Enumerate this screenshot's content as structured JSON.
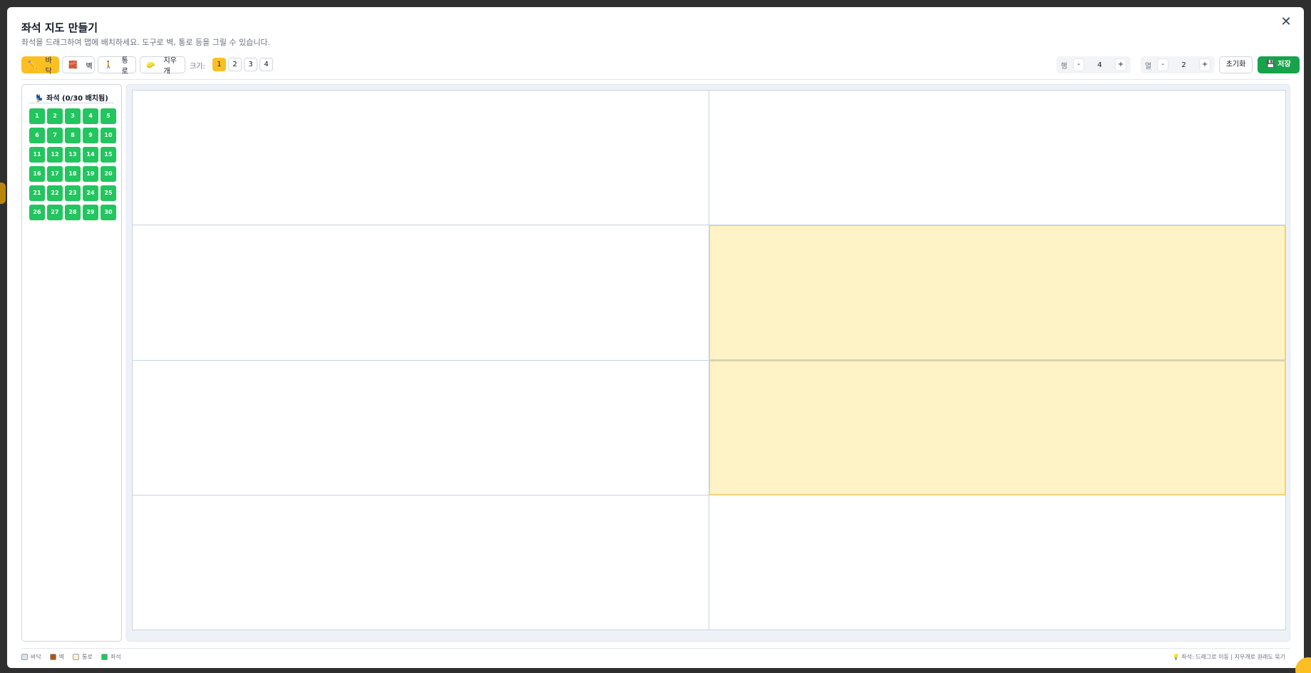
{
  "modal": {
    "title": "좌석 지도 만들기",
    "subtitle": "좌석을 드래그하여 맵에 배치하세요. 도구로 벽, 통로 등을 그릴 수 있습니다.",
    "close_label": "✕"
  },
  "toolbar": {
    "tools": [
      {
        "icon": "✏️",
        "label": "바닥",
        "active": true
      },
      {
        "icon": "🧱",
        "label": "벽",
        "active": false
      },
      {
        "icon": "🚶",
        "label": "통로",
        "active": false
      },
      {
        "icon": "🧽",
        "label": "지우개",
        "active": false
      }
    ],
    "size_label": "크기:",
    "sizes": [
      "1",
      "2",
      "3",
      "4"
    ],
    "selected_size": "1",
    "rows": {
      "label": "행",
      "value": "4",
      "minus": "-",
      "plus": "+"
    },
    "cols": {
      "label": "열",
      "value": "2",
      "minus": "-",
      "plus": "+"
    },
    "reset_label": "초기화",
    "save_label": "💾 저장"
  },
  "seat_panel": {
    "title": "💺 좌석 (0/30 배치됨)",
    "seats": [
      "1",
      "2",
      "3",
      "4",
      "5",
      "6",
      "7",
      "8",
      "9",
      "10",
      "11",
      "12",
      "13",
      "14",
      "15",
      "16",
      "17",
      "18",
      "19",
      "20",
      "21",
      "22",
      "23",
      "24",
      "25",
      "26",
      "27",
      "28",
      "29",
      "30"
    ]
  },
  "map": {
    "rows": 4,
    "cols": 2,
    "cells": [
      "floor",
      "floor",
      "floor",
      "aisle",
      "floor",
      "aisle",
      "floor",
      "floor"
    ]
  },
  "legend": [
    {
      "label": "바닥",
      "color": "#dbe4f0"
    },
    {
      "label": "벽",
      "color": "#b45309"
    },
    {
      "label": "통로",
      "color": "#fef3c7"
    },
    {
      "label": "좌석",
      "color": "#22c55e"
    }
  ],
  "hint": "💡 좌석: 드래그로 이동 | 지우개로 원래도 묶기",
  "colors": {
    "accent": "#fbbf24",
    "save": "#16a34a",
    "seat": "#22c55e",
    "aisle": "#fef3c7"
  }
}
